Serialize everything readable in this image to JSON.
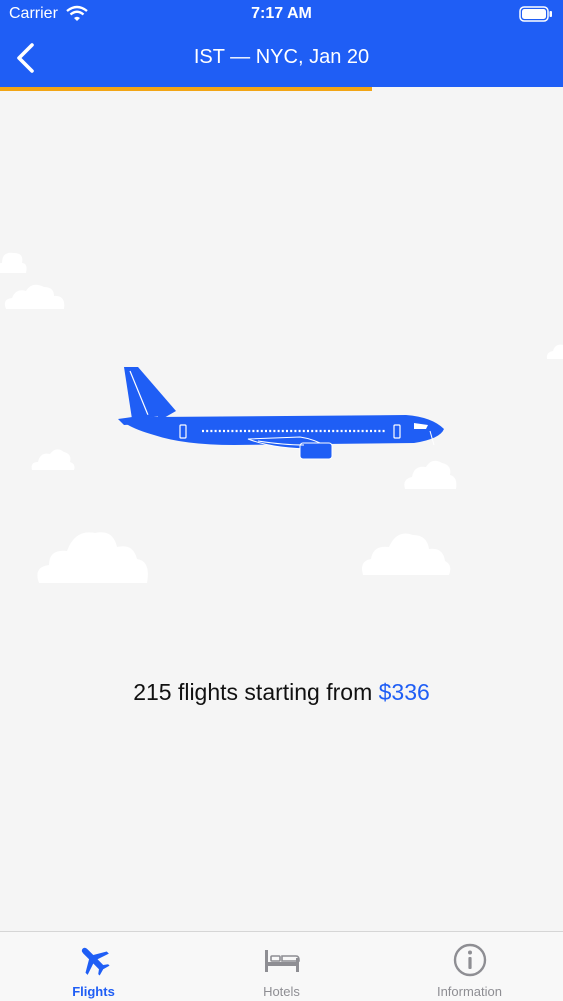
{
  "status_bar": {
    "carrier": "Carrier",
    "time": "7:17 AM"
  },
  "header": {
    "title": "IST — NYC, Jan 20"
  },
  "progress": {
    "fraction": 0.66,
    "color": "#f2a515"
  },
  "summary": {
    "text": "215 flights starting from ",
    "price": "$336"
  },
  "tabs": [
    {
      "label": "Flights",
      "icon": "airplane-icon",
      "active": true
    },
    {
      "label": "Hotels",
      "icon": "bed-icon",
      "active": false
    },
    {
      "label": "Information",
      "icon": "info-icon",
      "active": false
    }
  ],
  "colors": {
    "brand": "#1f5ef5",
    "accent": "#f2a515",
    "background": "#f5f5f5"
  }
}
